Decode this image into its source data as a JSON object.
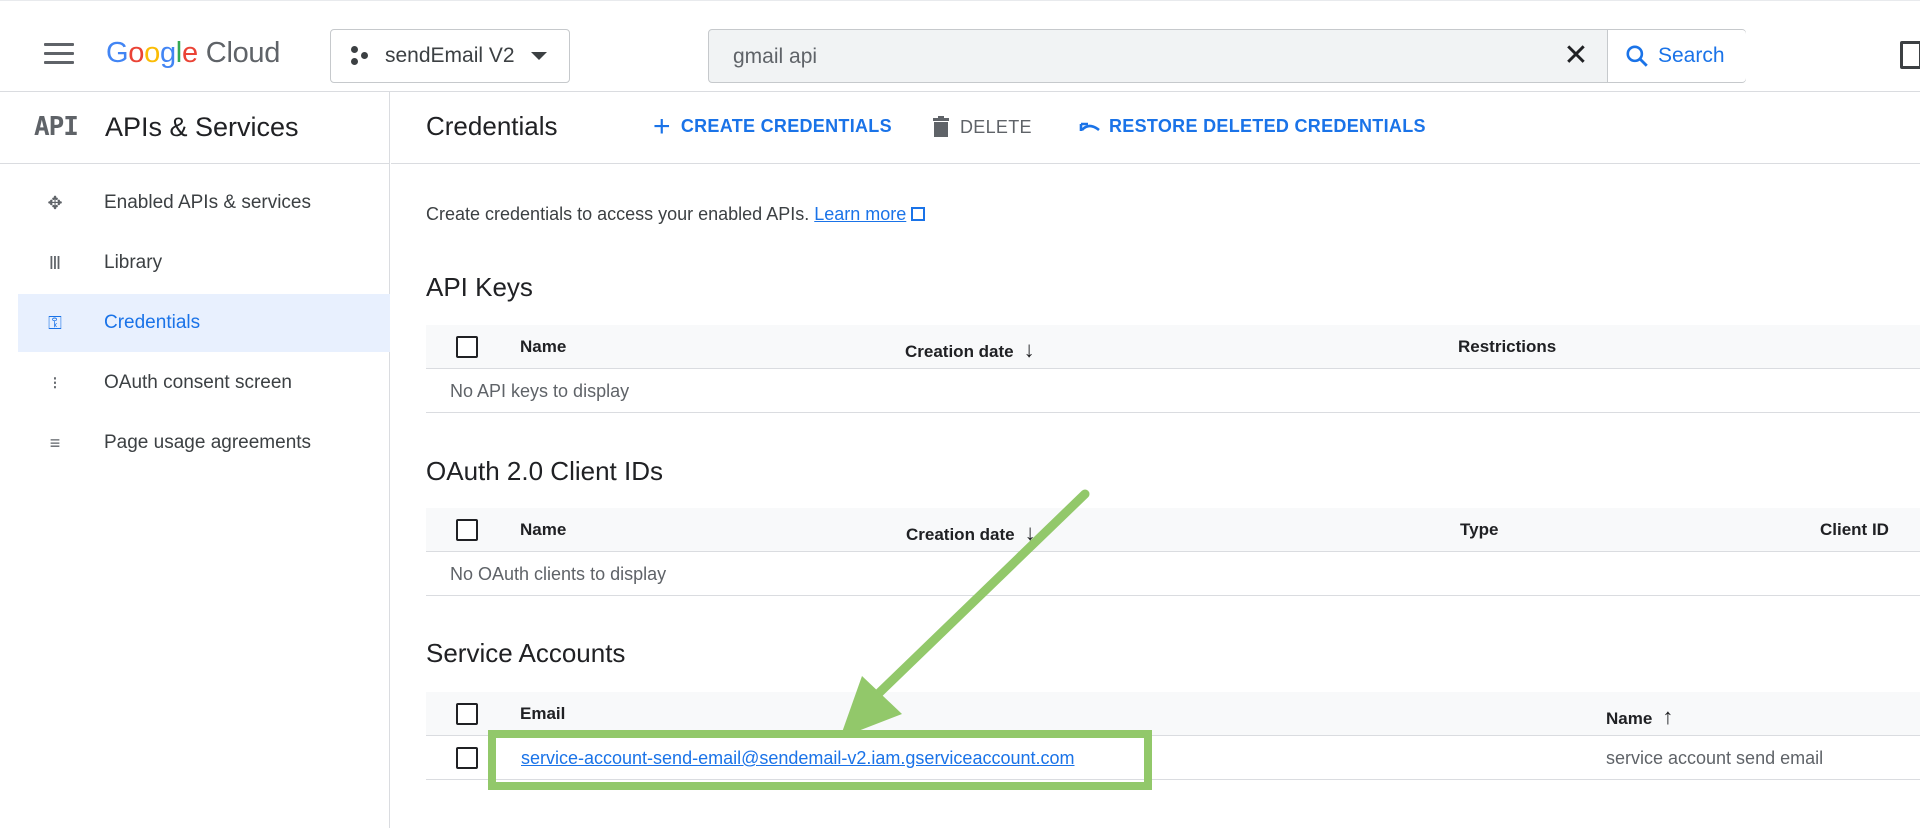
{
  "topbar": {
    "logo_google": "Google",
    "logo_cloud": "Cloud",
    "project_name": "sendEmail V2",
    "search_value": "gmail api",
    "search_button": "Search"
  },
  "sidebar": {
    "badge": "API",
    "title": "APIs & Services",
    "items": [
      {
        "label": "Enabled APIs & services",
        "icon": "api-hub-icon"
      },
      {
        "label": "Library",
        "icon": "library-icon"
      },
      {
        "label": "Credentials",
        "icon": "key-icon",
        "active": true
      },
      {
        "label": "OAuth consent screen",
        "icon": "consent-icon"
      },
      {
        "label": "Page usage agreements",
        "icon": "settings-list-icon"
      }
    ]
  },
  "header": {
    "title": "Credentials",
    "create": "CREATE CREDENTIALS",
    "delete": "DELETE",
    "restore": "RESTORE DELETED CREDENTIALS"
  },
  "intro": {
    "text": "Create credentials to access your enabled APIs.",
    "link": "Learn more"
  },
  "api_keys": {
    "title": "API Keys",
    "columns": [
      "Name",
      "Creation date",
      "Restrictions"
    ],
    "empty": "No API keys to display"
  },
  "oauth": {
    "title": "OAuth 2.0 Client IDs",
    "columns": [
      "Name",
      "Creation date",
      "Type",
      "Client ID"
    ],
    "empty": "No OAuth clients to display"
  },
  "service_accounts": {
    "title": "Service Accounts",
    "columns": [
      "Email",
      "Name"
    ],
    "rows": [
      {
        "email": "service-account-send-email@sendemail-v2.iam.gserviceaccount.com",
        "name": "service account send email"
      }
    ]
  },
  "colors": {
    "accent": "#1a73e8",
    "annotation": "#92c86a",
    "active_bg": "#e8f0fe"
  }
}
